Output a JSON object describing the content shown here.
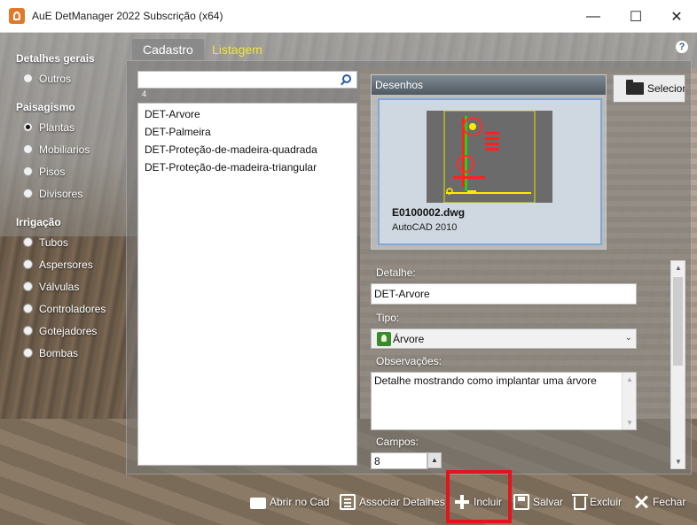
{
  "window": {
    "title": "AuE DetManager 2022 Subscrição (x64)",
    "controls": {
      "minimize": "—",
      "maximize": "☐",
      "close": "✕"
    }
  },
  "nav": {
    "groups": [
      {
        "label": "Detalhes gerais",
        "items": [
          {
            "label": "Outros",
            "selected": false
          }
        ]
      },
      {
        "label": "Paisagismo",
        "items": [
          {
            "label": "Plantas",
            "selected": true
          },
          {
            "label": "Mobiliarios",
            "selected": false
          },
          {
            "label": "Pisos",
            "selected": false
          },
          {
            "label": "Divisores",
            "selected": false
          }
        ]
      },
      {
        "label": "Irrigação",
        "items": [
          {
            "label": "Tubos",
            "selected": false
          },
          {
            "label": "Aspersores",
            "selected": false
          },
          {
            "label": "Válvulas",
            "selected": false
          },
          {
            "label": "Controladores",
            "selected": false
          },
          {
            "label": "Gotejadores",
            "selected": false
          },
          {
            "label": "Bombas",
            "selected": false
          }
        ]
      }
    ]
  },
  "tabs": {
    "cadastro": "Cadastro",
    "listagem": "Listagem",
    "help": "?"
  },
  "list": {
    "search_value": "",
    "count": "4",
    "items": [
      "DET-Arvore",
      "DET-Palmeira",
      "DET-Proteção-de-madeira-quadrada",
      "DET-Proteção-de-madeira-triangular"
    ]
  },
  "drawings": {
    "header": "Desenhos",
    "file_name": "E0100002.dwg",
    "file_type": "AutoCAD 2010",
    "select_button": "Selecionar"
  },
  "form": {
    "detalhe_label": "Detalhe:",
    "detalhe_value": "DET-Arvore",
    "tipo_label": "Tipo:",
    "tipo_value": "Árvore",
    "observacoes_label": "Observações:",
    "observacoes_value": "Detalhe mostrando como implantar uma árvore",
    "campos_label": "Campos:",
    "campos_value": "8"
  },
  "toolbar": {
    "abrir": "Abrir no Cad",
    "associar": "Associar Detalhes",
    "incluir": "Incluir",
    "salvar": "Salvar",
    "excluir": "Excluir",
    "fechar": "Fechar"
  },
  "colors": {
    "active_tab_text": "#f0e43a",
    "highlight": "#e3141d",
    "app_icon": "#e07a2b"
  }
}
